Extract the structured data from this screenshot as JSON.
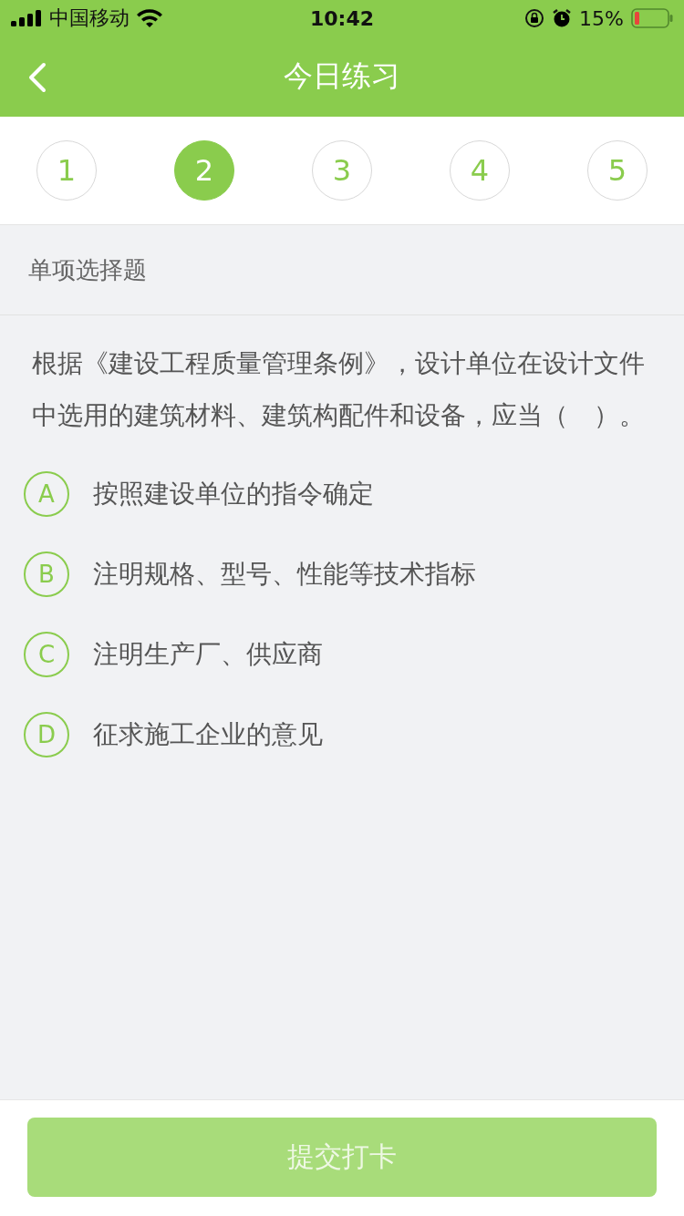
{
  "status_bar": {
    "carrier": "中国移动",
    "time": "10:42",
    "battery": "15%"
  },
  "nav": {
    "title": "今日练习"
  },
  "steps": [
    {
      "label": "1",
      "selected": false
    },
    {
      "label": "2",
      "selected": true
    },
    {
      "label": "3",
      "selected": false
    },
    {
      "label": "4",
      "selected": false
    },
    {
      "label": "5",
      "selected": false
    }
  ],
  "question": {
    "type": "单项选择题",
    "text": "根据《建设工程质量管理条例》，设计单位在设计文件中选用的建筑材料、建筑构配件和设备，应当（　）。",
    "options": [
      {
        "letter": "A",
        "text": "按照建设单位的指令确定"
      },
      {
        "letter": "B",
        "text": "注明规格、型号、性能等技术指标"
      },
      {
        "letter": "C",
        "text": "注明生产厂、供应商"
      },
      {
        "letter": "D",
        "text": "征求施工企业的意见"
      }
    ]
  },
  "submit": {
    "label": "提交打卡",
    "disabled": true
  }
}
